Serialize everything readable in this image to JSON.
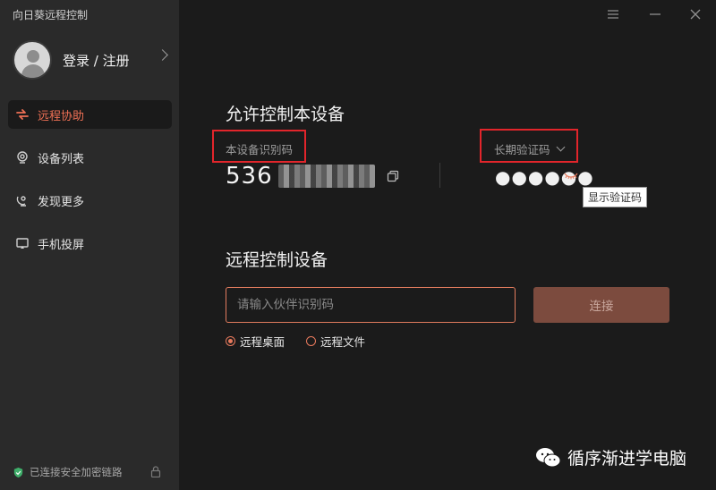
{
  "app": {
    "title": "向日葵远程控制"
  },
  "user": {
    "login_label": "登录 / 注册"
  },
  "nav": [
    {
      "label": "远程协助",
      "icon": "remote-assist-icon",
      "active": true
    },
    {
      "label": "设备列表",
      "icon": "device-list-icon",
      "active": false
    },
    {
      "label": "发现更多",
      "icon": "discover-icon",
      "active": false
    },
    {
      "label": "手机投屏",
      "icon": "screen-cast-icon",
      "active": false
    }
  ],
  "status": {
    "secure_text": "已连接安全加密链路"
  },
  "allow": {
    "title": "允许控制本设备",
    "device_id_label": "本设备识别码",
    "device_id_visible": "536",
    "password_type_label": "长期验证码",
    "password_mask": "●●●●●●",
    "tooltip": "显示验证码"
  },
  "remote": {
    "title": "远程控制设备",
    "input_placeholder": "请输入伙伴识别码",
    "connect_label": "连接",
    "options": [
      {
        "label": "远程桌面",
        "selected": true
      },
      {
        "label": "远程文件",
        "selected": false
      }
    ]
  },
  "watermark": {
    "text": "循序渐进学电脑"
  },
  "colors": {
    "accent": "#ef7055",
    "highlight_box": "#e2252b",
    "connect_bg": "#7c4b3e"
  }
}
